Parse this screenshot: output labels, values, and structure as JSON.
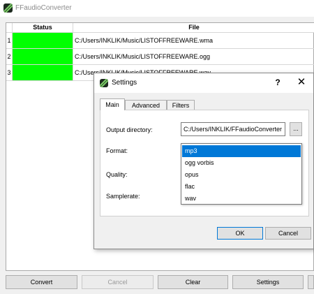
{
  "window": {
    "title": "FFaudioConverter"
  },
  "table": {
    "headers": {
      "status": "Status",
      "file": "File"
    },
    "rows": [
      {
        "num": "1",
        "status_color": "#00ff00",
        "file": "C:/Users/INKLIK/Music/LISTOFFREEWARE.wma"
      },
      {
        "num": "2",
        "status_color": "#00ff00",
        "file": "C:/Users/INKLIK/Music/LISTOFFREEWARE.ogg"
      },
      {
        "num": "3",
        "status_color": "#00ff00",
        "file": "C:/Users/INKLIK/Music/LISTOFFREEWARE.wav"
      }
    ]
  },
  "buttons": {
    "convert": "Convert",
    "cancel": "Cancel",
    "clear": "Clear",
    "settings": "Settings"
  },
  "settings_dialog": {
    "title": "Settings",
    "help": "?",
    "close": "✕",
    "tabs": [
      "Main",
      "Advanced",
      "Filters"
    ],
    "active_tab": "Main",
    "output_directory_label": "Output directory:",
    "output_directory_value": "C:/Users/INKLIK/FFaudioConverter",
    "browse_label": "...",
    "format_label": "Format:",
    "quality_label": "Quality:",
    "samplerate_label": "Samplerate:",
    "format_options": [
      "mp3",
      "ogg vorbis",
      "opus",
      "flac",
      "wav"
    ],
    "format_selected": "mp3",
    "ok_label": "OK",
    "cancel_label": "Cancel"
  },
  "colors": {
    "status_done": "#00ff00",
    "selection": "#0078d7"
  }
}
